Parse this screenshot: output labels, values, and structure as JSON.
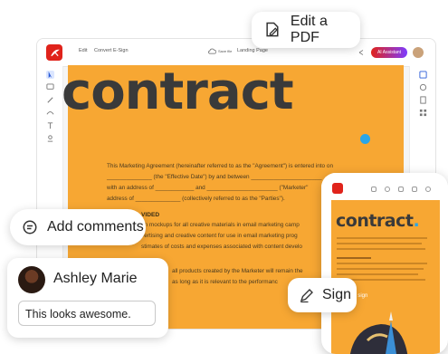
{
  "app": {
    "menu": [
      "Edit",
      "Convert",
      "E-Sign"
    ],
    "doc_title": "Landing Page",
    "save_status": "Save file",
    "ai_button": "AI Assistant"
  },
  "document": {
    "heading": "contract",
    "heading_dot": ".",
    "lines": [
      "This Marketing Agreement (hereinafter referred to as the \"Agreement\") is entered into on",
      "______________ (the \"Effective Date\") by and between ______________________",
      "with an address of ____________ and ______________________ (\"Marketer\"",
      "address of ______________ (collectively referred to as the \"Parties\")."
    ],
    "section_heading": "VIDED",
    "section_lines": [
      "gn mockups for all creative materials in email marketing camp",
      "vertising and creative content for use in email marketing prog",
      "stimates of costs and expenses associated with content develo",
      "all products created by the Marketer will remain the",
      "as long as it is relevant to the performanc"
    ]
  },
  "callouts": {
    "edit_pdf": "Edit a PDF",
    "add_comments": "Add comments",
    "sign": "Sign"
  },
  "comment": {
    "author": "Ashley Marie",
    "text": "This looks awesome."
  },
  "phone": {
    "heading": "contract",
    "heading_dot": ".",
    "sign_label": "Place to sign"
  },
  "colors": {
    "brand_red": "#e0231b",
    "page_orange": "#f7a733",
    "accent_blue": "#2ba6e8"
  }
}
